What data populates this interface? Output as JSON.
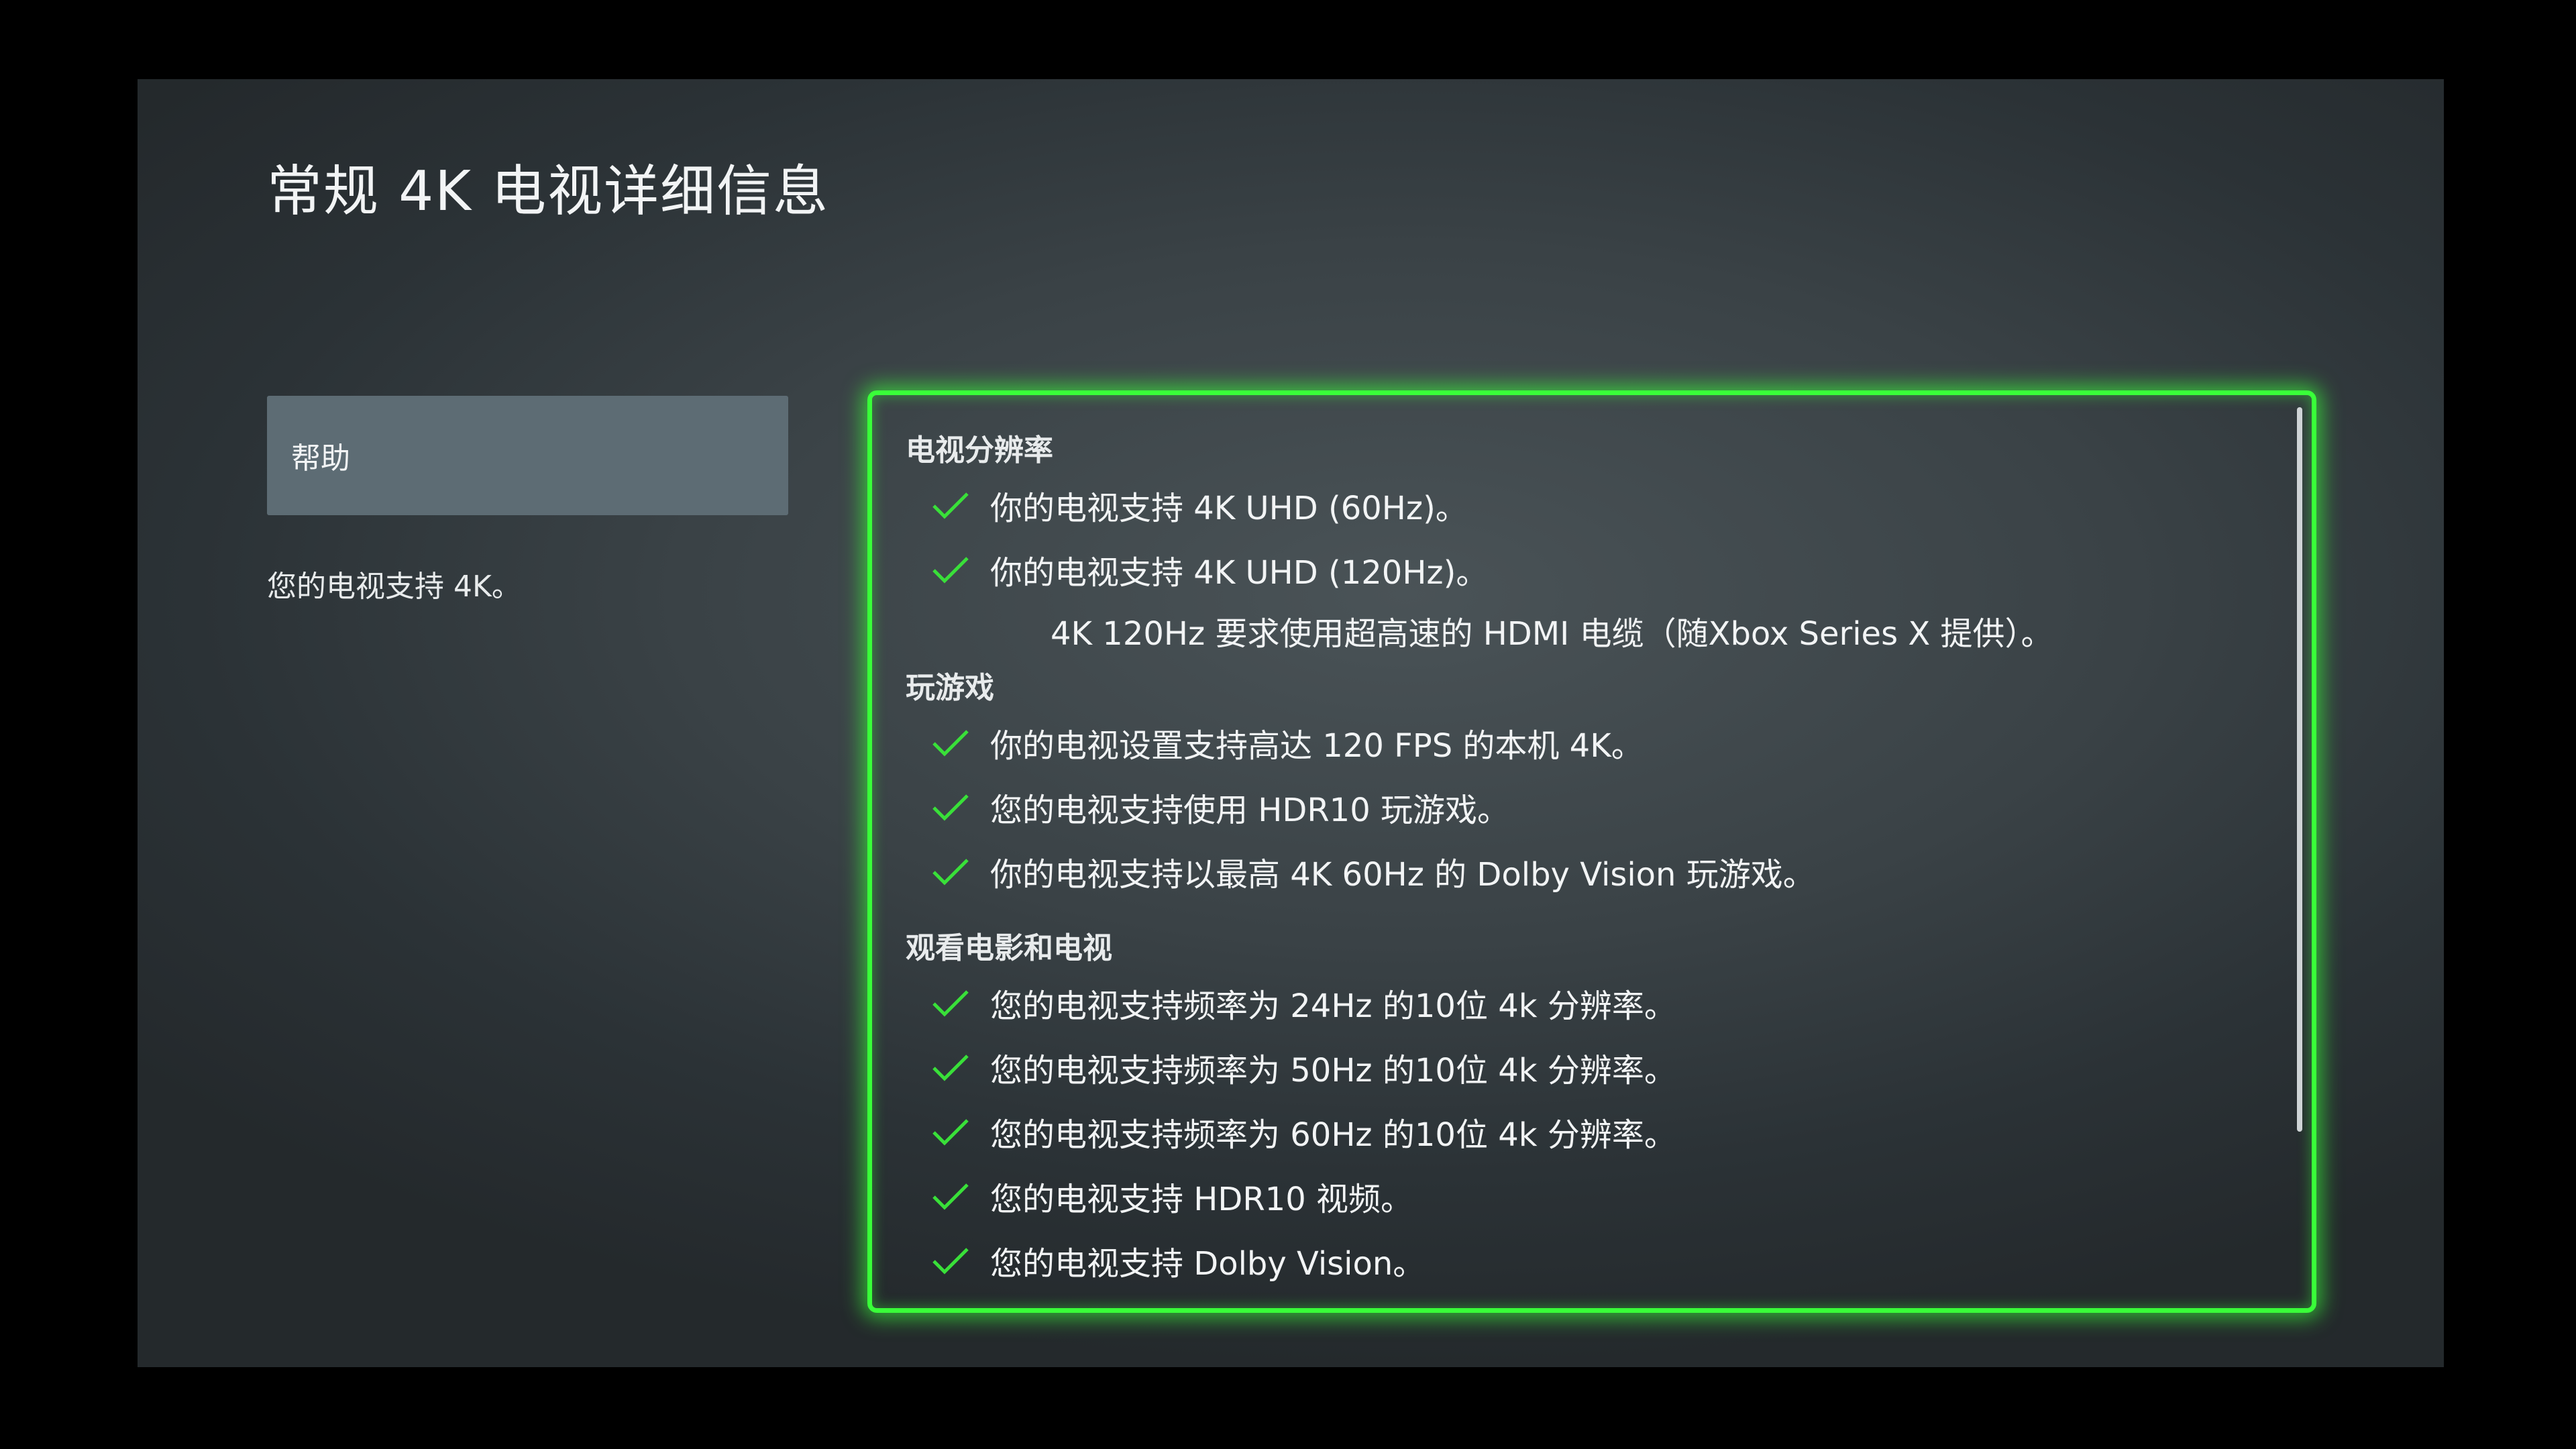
{
  "page": {
    "title": "常规 4K 电视详细信息"
  },
  "sidebar": {
    "help_label": "帮助",
    "description": "您的电视支持 4K。"
  },
  "colors": {
    "focus_outline": "#39ff39",
    "check": "#39e039",
    "help_button_bg": "#5d6c74"
  },
  "details": {
    "sections": [
      {
        "title": "电视分辨率",
        "items": [
          {
            "icon": "check-icon",
            "text": "你的电视支持 4K UHD (60Hz)。"
          },
          {
            "icon": "check-icon",
            "text": "你的电视支持 4K UHD (120Hz)。"
          }
        ],
        "note": "4K 120Hz 要求使用超高速的 HDMI 电缆（随Xbox Series X 提供）。"
      },
      {
        "title": "玩游戏",
        "items": [
          {
            "icon": "check-icon",
            "text": "你的电视设置支持高达 120 FPS 的本机 4K。"
          },
          {
            "icon": "check-icon",
            "text": "您的电视支持使用 HDR10 玩游戏。"
          },
          {
            "icon": "check-icon",
            "text": "你的电视支持以最高 4K 60Hz 的 Dolby Vision 玩游戏。"
          }
        ]
      },
      {
        "title": "观看电影和电视",
        "items": [
          {
            "icon": "check-icon",
            "text": "您的电视支持频率为 24Hz 的10位 4k 分辨率。"
          },
          {
            "icon": "check-icon",
            "text": "您的电视支持频率为 50Hz 的10位 4k 分辨率。"
          },
          {
            "icon": "check-icon",
            "text": "您的电视支持频率为 60Hz 的10位 4k 分辨率。"
          },
          {
            "icon": "check-icon",
            "text": "您的电视支持 HDR10 视频。"
          },
          {
            "icon": "check-icon",
            "text": "您的电视支持 Dolby Vision。"
          }
        ]
      }
    ]
  }
}
